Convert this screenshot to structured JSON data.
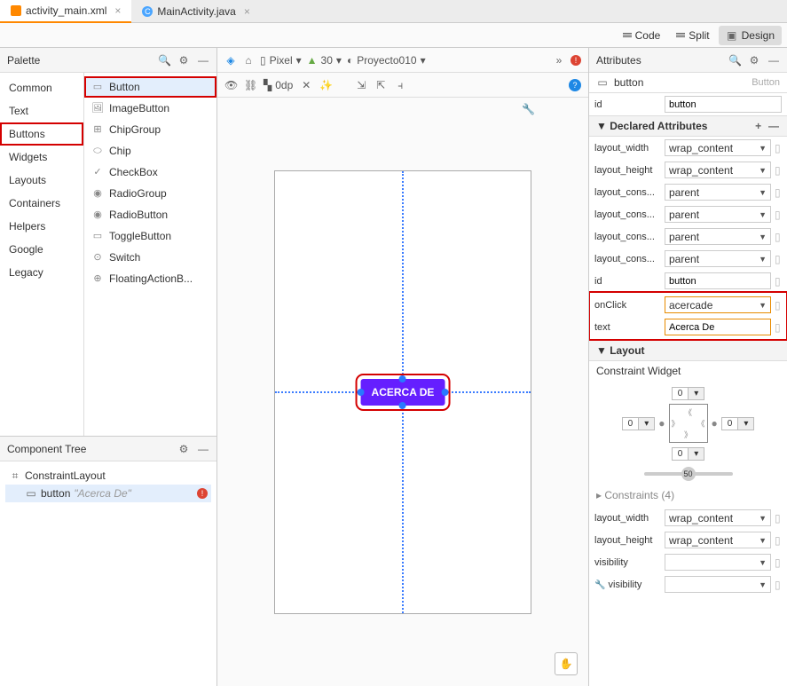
{
  "tabs": [
    {
      "name": "activity_main.xml",
      "active": true,
      "type": "xml"
    },
    {
      "name": "MainActivity.java",
      "active": false,
      "type": "java"
    }
  ],
  "view_modes": {
    "code": "Code",
    "split": "Split",
    "design": "Design",
    "active": "design"
  },
  "palette": {
    "title": "Palette",
    "categories": [
      "Common",
      "Text",
      "Buttons",
      "Widgets",
      "Layouts",
      "Containers",
      "Helpers",
      "Google",
      "Legacy"
    ],
    "selected": "Buttons",
    "widgets": [
      "Button",
      "ImageButton",
      "ChipGroup",
      "Chip",
      "CheckBox",
      "RadioGroup",
      "RadioButton",
      "ToggleButton",
      "Switch",
      "FloatingActionB..."
    ],
    "selected_widget": "Button"
  },
  "component_tree": {
    "title": "Component Tree",
    "root": "ConstraintLayout",
    "child": {
      "name": "button",
      "text": "\"Acerca De\""
    }
  },
  "designer": {
    "device": "Pixel",
    "api": "30",
    "project": "Proyecto010",
    "dp": "0dp",
    "button_text": "ACERCA DE"
  },
  "attributes": {
    "title": "Attributes",
    "element_name": "button",
    "element_type": "Button",
    "id": "button",
    "declared_title": "Declared Attributes",
    "declared": [
      {
        "k": "layout_width",
        "v": "wrap_content",
        "combo": true
      },
      {
        "k": "layout_height",
        "v": "wrap_content",
        "combo": true
      },
      {
        "k": "layout_cons...",
        "v": "parent",
        "combo": true
      },
      {
        "k": "layout_cons...",
        "v": "parent",
        "combo": true
      },
      {
        "k": "layout_cons...",
        "v": "parent",
        "combo": true
      },
      {
        "k": "layout_cons...",
        "v": "parent",
        "combo": true
      },
      {
        "k": "id",
        "v": "button",
        "combo": false
      }
    ],
    "highlighted": [
      {
        "k": "onClick",
        "v": "acercade",
        "combo": true
      },
      {
        "k": "text",
        "v": "Acerca De",
        "combo": false
      }
    ],
    "layout_title": "Layout",
    "constraint_widget_label": "Constraint Widget",
    "constraints_title": "Constraints",
    "constraints_count": "(4)",
    "layout_attrs": [
      {
        "k": "layout_width",
        "v": "wrap_content"
      },
      {
        "k": "layout_height",
        "v": "wrap_content"
      },
      {
        "k": "visibility",
        "v": ""
      },
      {
        "k": "visibility",
        "v": "",
        "icon": true
      }
    ],
    "cw_values": {
      "top": "0",
      "bottom": "0",
      "left": "0",
      "right": "0",
      "bias": "50"
    }
  }
}
